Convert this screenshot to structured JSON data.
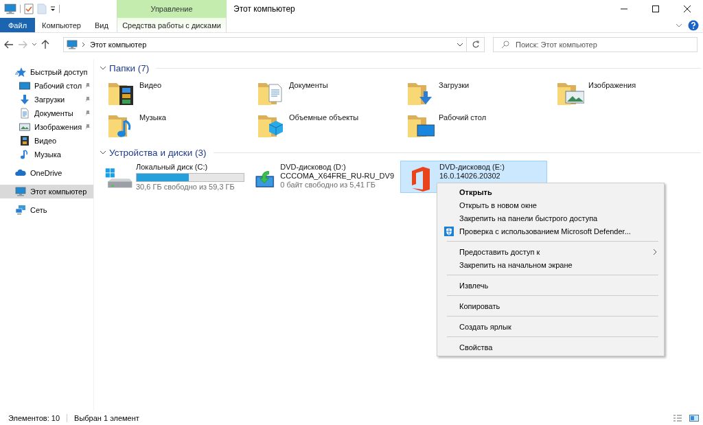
{
  "window": {
    "title": "Этот компьютер"
  },
  "ribbon": {
    "file_tab": "Файл",
    "tabs": [
      {
        "label": "Компьютер",
        "selected": false
      },
      {
        "label": "Вид",
        "selected": false
      }
    ],
    "contextual": {
      "header": "Управление",
      "tab": "Средства работы с дисками"
    }
  },
  "address": {
    "path": "Этот компьютер"
  },
  "search": {
    "placeholder": "Поиск: Этот компьютер"
  },
  "sidebar": {
    "items": [
      {
        "label": "Быстрый доступ",
        "kind": "star",
        "selected": false,
        "children": [
          {
            "label": "Рабочий стол",
            "kind": "desktop",
            "pinned": true,
            "selected": false
          },
          {
            "label": "Загрузки",
            "kind": "downloads",
            "pinned": true,
            "selected": false
          },
          {
            "label": "Документы",
            "kind": "documents",
            "pinned": true,
            "selected": false
          },
          {
            "label": "Изображения",
            "kind": "images",
            "pinned": true,
            "selected": false
          },
          {
            "label": "Видео",
            "kind": "video",
            "pinned": false,
            "selected": false
          },
          {
            "label": "Музыка",
            "kind": "music",
            "pinned": false,
            "selected": false
          }
        ]
      },
      {
        "label": "OneDrive",
        "kind": "cloud",
        "selected": false
      },
      {
        "label": "Этот компьютер",
        "kind": "pc",
        "selected": true
      },
      {
        "label": "Сеть",
        "kind": "network",
        "selected": false
      }
    ]
  },
  "groups": [
    {
      "title": "Папки (7)",
      "kind": "folders",
      "expanded": true,
      "items": [
        {
          "label": "Видео",
          "kind": "video",
          "selected": false
        },
        {
          "label": "Документы",
          "kind": "documents",
          "selected": false
        },
        {
          "label": "Загрузки",
          "kind": "downloads",
          "selected": false
        },
        {
          "label": "Изображения",
          "kind": "images",
          "selected": false
        },
        {
          "label": "Музыка",
          "kind": "music",
          "selected": false
        },
        {
          "label": "Объемные объекты",
          "kind": "cube",
          "selected": false
        },
        {
          "label": "Рабочий стол",
          "kind": "desktop",
          "selected": false
        }
      ]
    },
    {
      "title": "Устройства и диски (3)",
      "kind": "drives",
      "expanded": true,
      "items": [
        {
          "label": "Локальный диск (C:)",
          "kind": "hdd",
          "level": 0.49,
          "detail": "30,6 ГБ свободно из 59,3 ГБ",
          "selected": false
        },
        {
          "label": "DVD-дисковод (D:)",
          "kind": "dvd",
          "subtitle": "CCCOMA_X64FRE_RU-RU_DV9",
          "detail": "0 байт свободно из 5,41 ГБ",
          "selected": false
        },
        {
          "label": "DVD-дисковод (E:)",
          "kind": "office",
          "subtitle": "16.0.14026.20302",
          "selected": true
        }
      ]
    }
  ],
  "context_menu": {
    "groups": [
      {
        "items": [
          {
            "label": "Открыть",
            "kind": "default"
          },
          {
            "label": "Открыть в новом окне",
            "kind": "plain"
          },
          {
            "label": "Закрепить на панели быстрого доступа",
            "kind": "plain"
          },
          {
            "label": "Проверка с использованием Microsoft Defender...",
            "kind": "scan"
          }
        ]
      },
      {
        "items": [
          {
            "label": "Предоставить доступ к",
            "kind": "submenu"
          },
          {
            "label": "Закрепить на начальном экране",
            "kind": "plain"
          }
        ]
      },
      {
        "items": [
          {
            "label": "Извлечь",
            "kind": "plain"
          }
        ]
      },
      {
        "items": [
          {
            "label": "Копировать",
            "kind": "plain"
          }
        ]
      },
      {
        "items": [
          {
            "label": "Создать ярлык",
            "kind": "plain"
          }
        ]
      },
      {
        "items": [
          {
            "label": "Свойства",
            "kind": "plain"
          }
        ]
      }
    ]
  },
  "status_bar": {
    "item_count": "Элементов: 10",
    "selection": "Выбран 1 элемент"
  }
}
